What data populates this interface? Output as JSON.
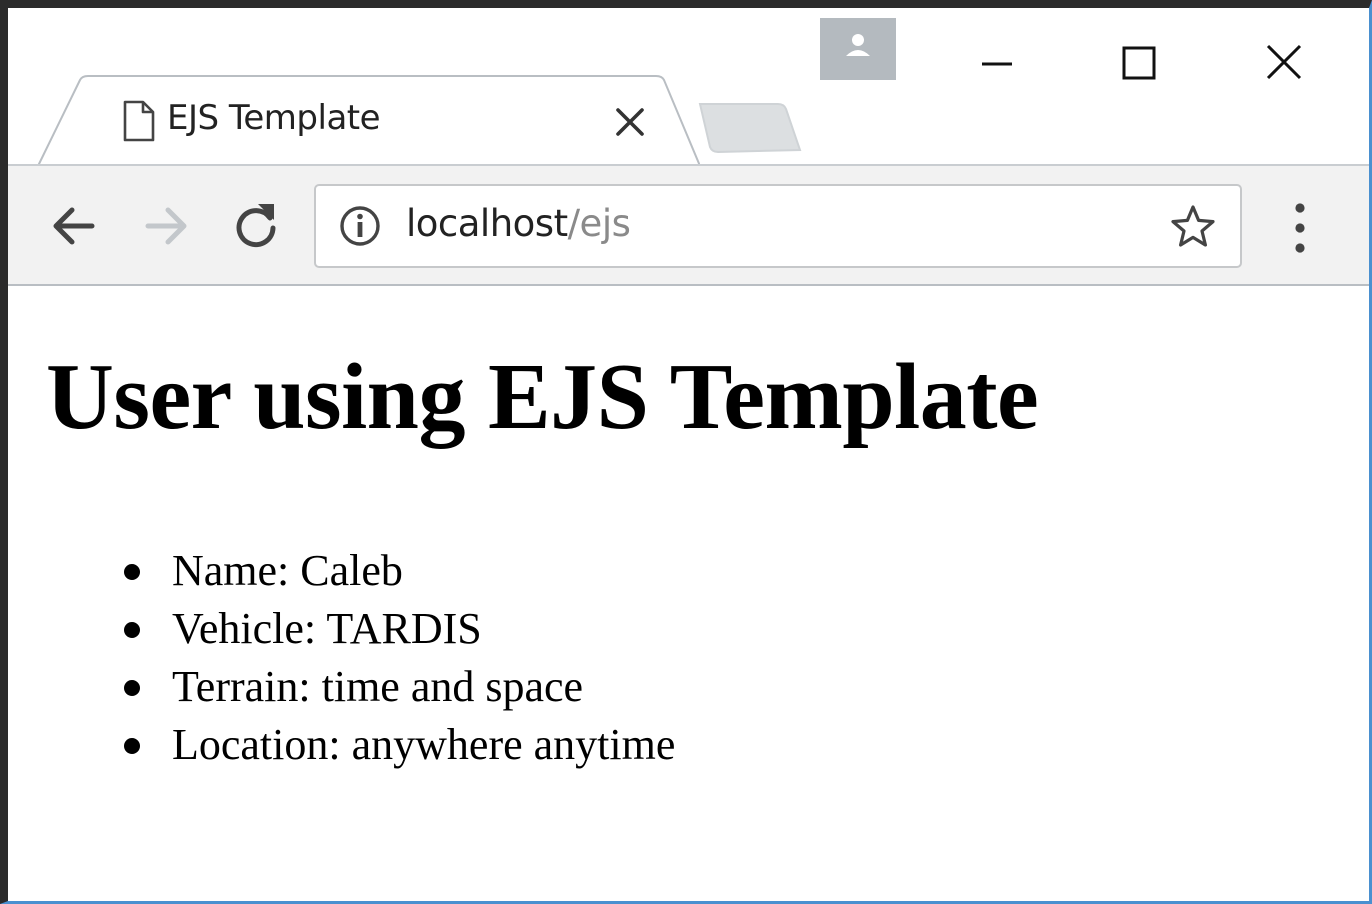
{
  "tab": {
    "title": "EJS Template"
  },
  "address_bar": {
    "host": "localhost",
    "path": "/ejs"
  },
  "page": {
    "heading": "User using EJS Template",
    "items": [
      "Name: Caleb",
      "Vehicle: TARDIS",
      "Terrain: time and space",
      "Location: anywhere anytime"
    ]
  },
  "icons": {
    "tab": "document-icon",
    "tab_close": "close-icon",
    "new_tab": "new-tab-icon",
    "profile": "person-icon",
    "minimize": "minimize-icon",
    "maximize": "maximize-icon",
    "window_close": "close-icon",
    "back": "arrow-left-icon",
    "forward": "arrow-right-icon",
    "reload": "reload-icon",
    "site_info": "info-icon",
    "bookmark": "star-icon",
    "menu": "kebab-menu-icon"
  },
  "colors": {
    "window_border": "#2b2b2b",
    "window_accent_border": "#4a90d0",
    "toolbar_bg": "#f2f2f2",
    "url_path": "#8a8a8a",
    "forward_disabled": "#c3c7cb"
  }
}
